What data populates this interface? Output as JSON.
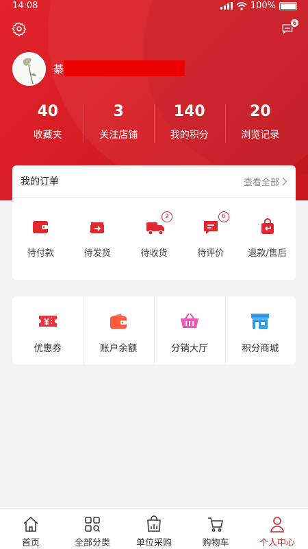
{
  "status": {
    "time": "14:08",
    "battery": "100%"
  },
  "header": {
    "message_badge": "6",
    "user_name": "綦"
  },
  "stats": [
    {
      "value": "40",
      "label": "收藏夹"
    },
    {
      "value": "3",
      "label": "关注店铺"
    },
    {
      "value": "140",
      "label": "我的积分"
    },
    {
      "value": "20",
      "label": "浏览记录"
    }
  ],
  "orders": {
    "title": "我的订单",
    "view_all": "查看全部",
    "items": [
      {
        "label": "待付款",
        "badge": ""
      },
      {
        "label": "待发货",
        "badge": ""
      },
      {
        "label": "待收货",
        "badge": "2"
      },
      {
        "label": "待评价",
        "badge": "6"
      },
      {
        "label": "退款/售后",
        "badge": ""
      }
    ]
  },
  "tools": [
    {
      "label": "优惠券",
      "icon": "coupon-icon"
    },
    {
      "label": "账户余额",
      "icon": "wallet-icon"
    },
    {
      "label": "分销大厅",
      "icon": "basket-icon"
    },
    {
      "label": "积分商城",
      "icon": "store-icon"
    }
  ],
  "tabbar": [
    {
      "label": "首页",
      "icon": "home-icon"
    },
    {
      "label": "全部分类",
      "icon": "category-icon"
    },
    {
      "label": "单位采购",
      "icon": "purchase-bag-icon"
    },
    {
      "label": "购物车",
      "icon": "cart-icon"
    },
    {
      "label": "个人中心",
      "icon": "person-icon",
      "active": true
    }
  ],
  "colors": {
    "brand_red": "#d9232b",
    "header_red": "#e3232b"
  }
}
